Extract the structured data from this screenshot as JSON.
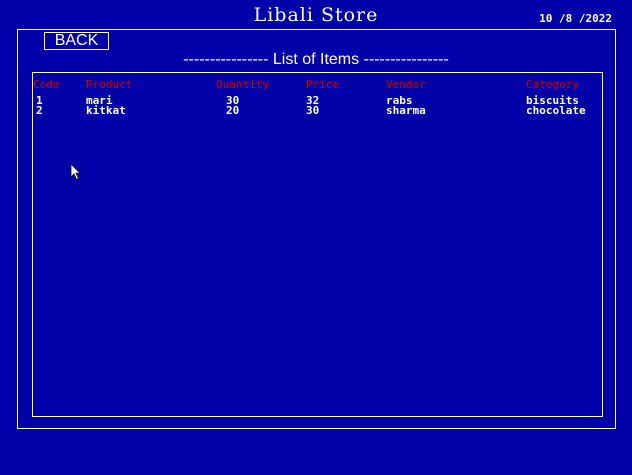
{
  "app": {
    "title": "Libali Store",
    "date": "10 /8 /2022"
  },
  "toolbar": {
    "back_label": "BACK"
  },
  "list": {
    "heading": "---------------- List of Items ----------------",
    "columns": {
      "code": "Code",
      "product": "Product",
      "quantity": "Quantity",
      "price": "Price",
      "vendor": "Vendor",
      "category": "Category"
    },
    "rows": [
      {
        "code": "1",
        "product": "mari",
        "quantity": "30",
        "price": "32",
        "vendor": "rabs",
        "category": "biscuits"
      },
      {
        "code": "2",
        "product": "kitkat",
        "quantity": "20",
        "price": "30",
        "vendor": "sharma",
        "category": "chocolate"
      }
    ]
  },
  "colors": {
    "background": "#0000a8",
    "header_text": "#c80000",
    "text": "#ffffff"
  },
  "icons": {
    "cursor": "mouse-pointer-icon"
  }
}
